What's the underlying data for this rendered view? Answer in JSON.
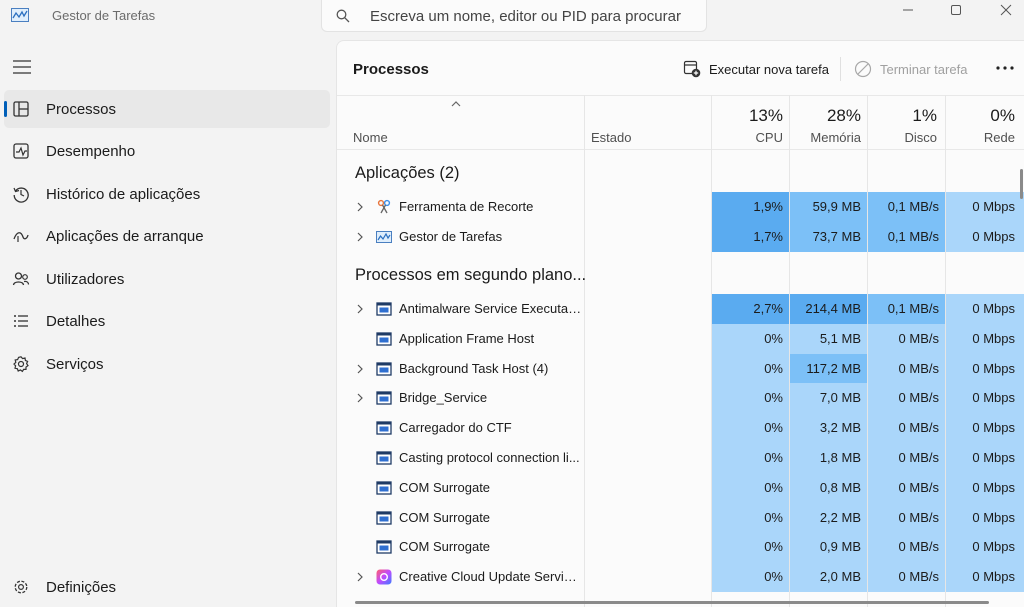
{
  "app": {
    "title": "Gestor de Tarefas"
  },
  "search": {
    "placeholder": "Escreva um nome, editor ou PID para procurar"
  },
  "sidebar": {
    "items": [
      {
        "label": "Processos",
        "icon": "processes-icon",
        "active": true
      },
      {
        "label": "Desempenho",
        "icon": "performance-icon"
      },
      {
        "label": "Histórico de aplicações",
        "icon": "history-icon"
      },
      {
        "label": "Aplicações de arranque",
        "icon": "startup-icon"
      },
      {
        "label": "Utilizadores",
        "icon": "users-icon"
      },
      {
        "label": "Detalhes",
        "icon": "details-icon"
      },
      {
        "label": "Serviços",
        "icon": "services-icon"
      }
    ],
    "settings_label": "Definições"
  },
  "toolbar": {
    "title": "Processos",
    "run_new_task": "Executar nova tarefa",
    "end_task": "Terminar tarefa"
  },
  "table": {
    "columns": {
      "name": "Nome",
      "status": "Estado",
      "cpu": {
        "pct": "13%",
        "label": "CPU"
      },
      "memory": {
        "pct": "28%",
        "label": "Memória"
      },
      "disk": {
        "pct": "1%",
        "label": "Disco"
      },
      "network": {
        "pct": "0%",
        "label": "Rede"
      }
    },
    "groups": {
      "apps": "Aplicações (2)",
      "background": "Processos em segundo plano..."
    },
    "apps": [
      {
        "name": "Ferramenta de Recorte",
        "cpu": "1,9%",
        "mem": "59,9 MB",
        "disk": "0,1 MB/s",
        "net": "0 Mbps",
        "expand": true,
        "icon": "snipping-tool-icon"
      },
      {
        "name": "Gestor de Tarefas",
        "cpu": "1,7%",
        "mem": "73,7 MB",
        "disk": "0,1 MB/s",
        "net": "0 Mbps",
        "expand": true,
        "icon": "task-manager-icon"
      }
    ],
    "background": [
      {
        "name": "Antimalware Service Executable",
        "cpu": "2,7%",
        "mem": "214,4 MB",
        "disk": "0,1 MB/s",
        "net": "0 Mbps",
        "expand": true,
        "icon": "process-window-icon"
      },
      {
        "name": "Application Frame Host",
        "cpu": "0%",
        "mem": "5,1 MB",
        "disk": "0 MB/s",
        "net": "0 Mbps",
        "expand": false,
        "icon": "process-window-icon"
      },
      {
        "name": "Background Task Host (4)",
        "cpu": "0%",
        "mem": "117,2 MB",
        "disk": "0 MB/s",
        "net": "0 Mbps",
        "expand": true,
        "icon": "process-window-icon"
      },
      {
        "name": "Bridge_Service",
        "cpu": "0%",
        "mem": "7,0 MB",
        "disk": "0 MB/s",
        "net": "0 Mbps",
        "expand": true,
        "icon": "process-window-icon"
      },
      {
        "name": "Carregador do CTF",
        "cpu": "0%",
        "mem": "3,2 MB",
        "disk": "0 MB/s",
        "net": "0 Mbps",
        "expand": false,
        "icon": "process-window-icon"
      },
      {
        "name": "Casting protocol connection li...",
        "cpu": "0%",
        "mem": "1,8 MB",
        "disk": "0 MB/s",
        "net": "0 Mbps",
        "expand": false,
        "icon": "process-window-icon"
      },
      {
        "name": "COM Surrogate",
        "cpu": "0%",
        "mem": "0,8 MB",
        "disk": "0 MB/s",
        "net": "0 Mbps",
        "expand": false,
        "icon": "process-window-icon"
      },
      {
        "name": "COM Surrogate",
        "cpu": "0%",
        "mem": "2,2 MB",
        "disk": "0 MB/s",
        "net": "0 Mbps",
        "expand": false,
        "icon": "process-window-icon"
      },
      {
        "name": "COM Surrogate",
        "cpu": "0%",
        "mem": "0,9 MB",
        "disk": "0 MB/s",
        "net": "0 Mbps",
        "expand": false,
        "icon": "process-window-icon"
      },
      {
        "name": "Creative Cloud Update Service...",
        "cpu": "0%",
        "mem": "2,0 MB",
        "disk": "0 MB/s",
        "net": "0 Mbps",
        "expand": true,
        "icon": "creative-cloud-icon"
      }
    ]
  },
  "colors": {
    "accent": "#005fb8",
    "heat_low": "#aad6fa",
    "heat_mid": "#7cc0f7",
    "heat_high": "#5aabf0"
  }
}
